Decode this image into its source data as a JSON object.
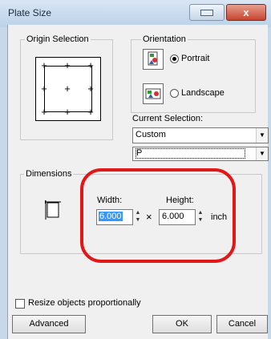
{
  "window": {
    "title": "Plate Size",
    "close_glyph": "x"
  },
  "origin": {
    "label": "Origin Selection"
  },
  "orientation": {
    "label": "Orientation",
    "portrait_label": "Portrait",
    "landscape_label": "Landscape",
    "selected": "Portrait"
  },
  "current_selection": {
    "label": "Current Selection:",
    "value": "Custom",
    "second_value": "P"
  },
  "dimensions": {
    "label": "Dimensions",
    "width_label": "Width:",
    "height_label": "Height:",
    "width_value": "6.000",
    "height_value": "6.000",
    "times_symbol": "×",
    "unit": "inch"
  },
  "resize": {
    "label": "Resize objects proportionally",
    "checked": false
  },
  "buttons": {
    "advanced": "Advanced",
    "ok": "OK",
    "cancel": "Cancel"
  },
  "colors": {
    "annotation": "#e01818",
    "selection": "#3399ff"
  }
}
